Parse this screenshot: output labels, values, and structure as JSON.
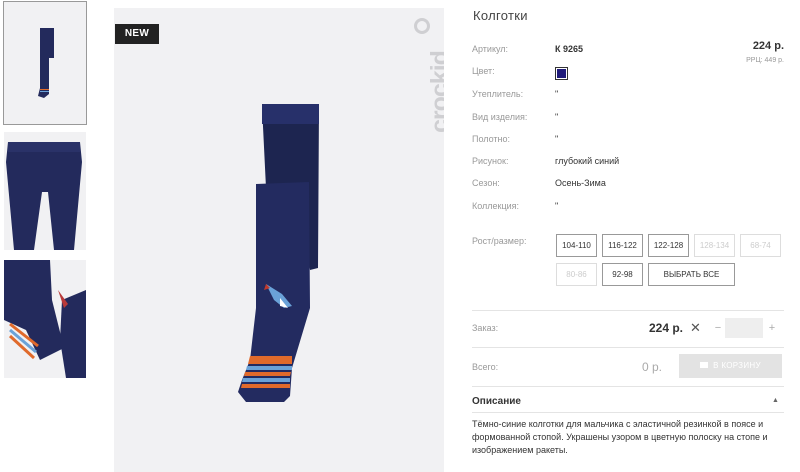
{
  "badge": "NEW",
  "brand": "crockid",
  "product": {
    "title": "Колготки",
    "price": "224 р.",
    "rrp": "РРЦ: 449 р.",
    "color_hex": "#1f1a7a"
  },
  "specs": [
    {
      "label": "Артикул:",
      "value": "К 9265"
    },
    {
      "label": "Цвет:",
      "value": ""
    },
    {
      "label": "Утеплитель:",
      "value": "\""
    },
    {
      "label": "Вид изделия:",
      "value": "\""
    },
    {
      "label": "Полотно:",
      "value": "\""
    },
    {
      "label": "Рисунок:",
      "value": "глубокий синий"
    },
    {
      "label": "Сезон:",
      "value": "Осень-Зима"
    },
    {
      "label": "Коллекция:",
      "value": "\""
    }
  ],
  "sizes": {
    "label": "Рост/размер:",
    "options": [
      {
        "label": "104-110",
        "available": true
      },
      {
        "label": "116-122",
        "available": true
      },
      {
        "label": "122-128",
        "available": true
      },
      {
        "label": "128-134",
        "available": false
      },
      {
        "label": "68-74",
        "available": false
      },
      {
        "label": "80-86",
        "available": false
      },
      {
        "label": "92-98",
        "available": true
      },
      {
        "label": "ВЫБРАТЬ ВСЕ",
        "available": true
      }
    ]
  },
  "order": {
    "label": "Заказ:",
    "price": "224 р.",
    "multiply": "✕",
    "minus": "−",
    "plus": "+",
    "quantity": ""
  },
  "total": {
    "label": "Всего:",
    "value": "0 р.",
    "cart_button": "В КОРЗИНУ"
  },
  "description": {
    "title": "Описание",
    "caret": "▲",
    "text": "Тёмно-синие колготки для мальчика с эластичной резинкой в поясе и формованной стопой. Украшены узором в цветную полоску на стопе и изображением ракеты."
  }
}
